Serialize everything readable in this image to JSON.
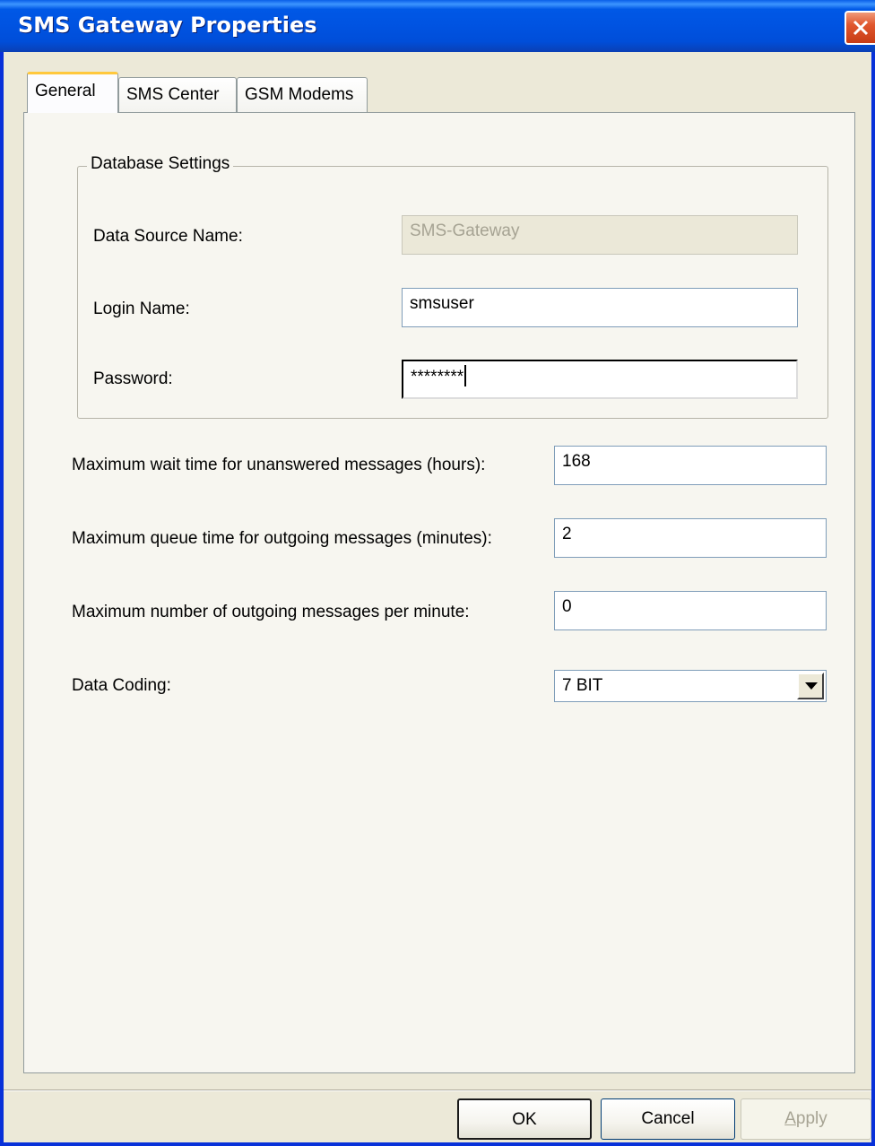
{
  "window": {
    "title": "SMS Gateway Properties"
  },
  "tabs": [
    {
      "label": "General",
      "selected": true
    },
    {
      "label": "SMS Center",
      "selected": false
    },
    {
      "label": "GSM Modems",
      "selected": false
    }
  ],
  "database": {
    "group_title": "Database Settings",
    "dsn_label": "Data Source Name:",
    "dsn_value": "SMS-Gateway",
    "login_label": "Login Name:",
    "login_value": "smsuser",
    "password_label": "Password:",
    "password_value": "********"
  },
  "settings": {
    "wait_label": "Maximum wait time for unanswered messages (hours):",
    "wait_value": "168",
    "queue_label": "Maximum queue time for outgoing messages (minutes):",
    "queue_value": "2",
    "rate_label": "Maximum number of outgoing messages per minute:",
    "rate_value": "0",
    "coding_label": "Data Coding:",
    "coding_value": "7 BIT"
  },
  "buttons": {
    "ok": "OK",
    "cancel": "Cancel",
    "apply_prefix": "",
    "apply_mnemonic": "A",
    "apply_rest": "pply"
  },
  "colors": {
    "titlebar": "#0054e3",
    "close": "#e0572e",
    "dialog_bg": "#ece9d8"
  }
}
